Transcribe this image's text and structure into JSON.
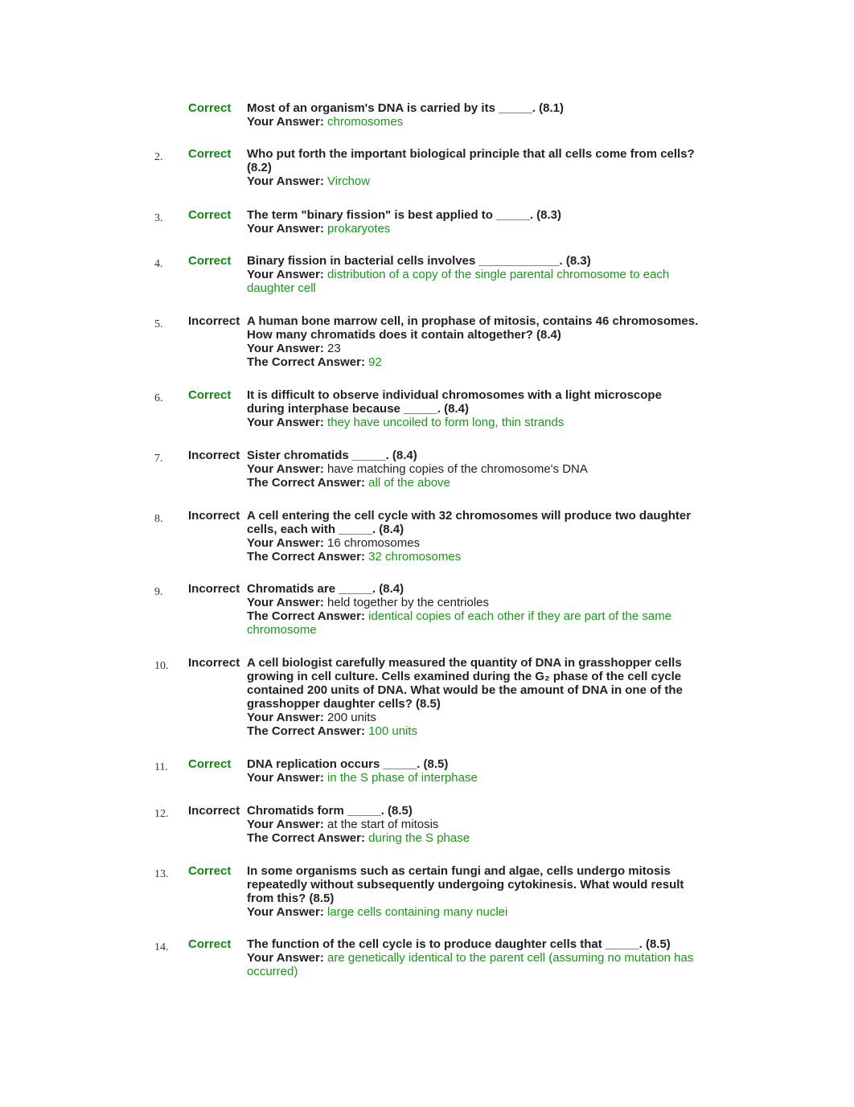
{
  "colors": {
    "correct": "#118811",
    "answer_correct": "#1a961a",
    "text": "#222222"
  },
  "labels": {
    "your_answer": "Your Answer:",
    "correct_answer": "The Correct Answer:"
  },
  "items": [
    {
      "number": "",
      "status": "Correct",
      "question": "Most of an organism's DNA is carried by its _____. (8.1)",
      "your_answer": "chromosomes",
      "is_correct": true
    },
    {
      "number": "2.",
      "status": "Correct",
      "question": "Who put forth the important biological principle that all cells come from cells? (8.2)",
      "your_answer": "Virchow",
      "is_correct": true
    },
    {
      "number": "3.",
      "status": "Correct",
      "question": "The term \"binary fission\" is best applied to _____. (8.3)",
      "your_answer": "prokaryotes",
      "is_correct": true
    },
    {
      "number": "4.",
      "status": "Correct",
      "question": "Binary fission in bacterial cells involves ____________. (8.3)",
      "your_answer": "distribution of a copy of the single parental chromosome to each daughter cell",
      "is_correct": true
    },
    {
      "number": "5.",
      "status": "Incorrect",
      "question": "A human bone marrow cell, in prophase of mitosis, contains 46 chromosomes. How many chromatids does it contain altogether? (8.4)",
      "your_answer": "23",
      "is_correct": false,
      "correct_answer": "92"
    },
    {
      "number": "6.",
      "status": "Correct",
      "question": "It is difficult to observe individual chromosomes with a light microscope during interphase because _____. (8.4)",
      "your_answer": "they have uncoiled to form long, thin strands",
      "is_correct": true
    },
    {
      "number": "7.",
      "status": "Incorrect",
      "question": "Sister chromatids _____. (8.4)",
      "your_answer": "have matching copies of the chromosome's DNA",
      "is_correct": false,
      "correct_answer": "all of the above"
    },
    {
      "number": "8.",
      "status": "Incorrect",
      "question": "A cell entering the cell cycle with 32 chromosomes will produce two daughter cells, each with _____. (8.4)",
      "your_answer": "16 chromosomes",
      "is_correct": false,
      "correct_answer": "32 chromosomes"
    },
    {
      "number": "9.",
      "status": "Incorrect",
      "question": "Chromatids are _____. (8.4)",
      "your_answer": "held together by the centrioles",
      "is_correct": false,
      "correct_answer": "identical copies of each other if they are part of the same chromosome"
    },
    {
      "number": "10.",
      "status": "Incorrect",
      "question": "A cell biologist carefully measured the quantity of DNA in grasshopper cells growing in cell culture. Cells examined during the G₂ phase of the cell cycle contained 200 units of DNA. What would be the amount of DNA in one of the grasshopper daughter cells? (8.5)",
      "your_answer": "200 units",
      "is_correct": false,
      "correct_answer": "100 units"
    },
    {
      "number": "11.",
      "status": "Correct",
      "question": "DNA replication occurs _____. (8.5)",
      "your_answer": "in the S phase of interphase",
      "is_correct": true
    },
    {
      "number": "12.",
      "status": "Incorrect",
      "question": "Chromatids form _____. (8.5)",
      "your_answer": "at the start of mitosis",
      "is_correct": false,
      "correct_answer": "during the S phase"
    },
    {
      "number": "13.",
      "status": "Correct",
      "question": "In some organisms such as certain fungi and algae, cells undergo mitosis repeatedly without subsequently undergoing cytokinesis. What would result from this? (8.5)",
      "your_answer": "large cells containing many nuclei",
      "is_correct": true
    },
    {
      "number": "14.",
      "status": "Correct",
      "question": "The function of the cell cycle is to produce daughter cells that _____. (8.5)",
      "your_answer": "are genetically identical to the parent cell (assuming no mutation has occurred)",
      "is_correct": true
    }
  ]
}
